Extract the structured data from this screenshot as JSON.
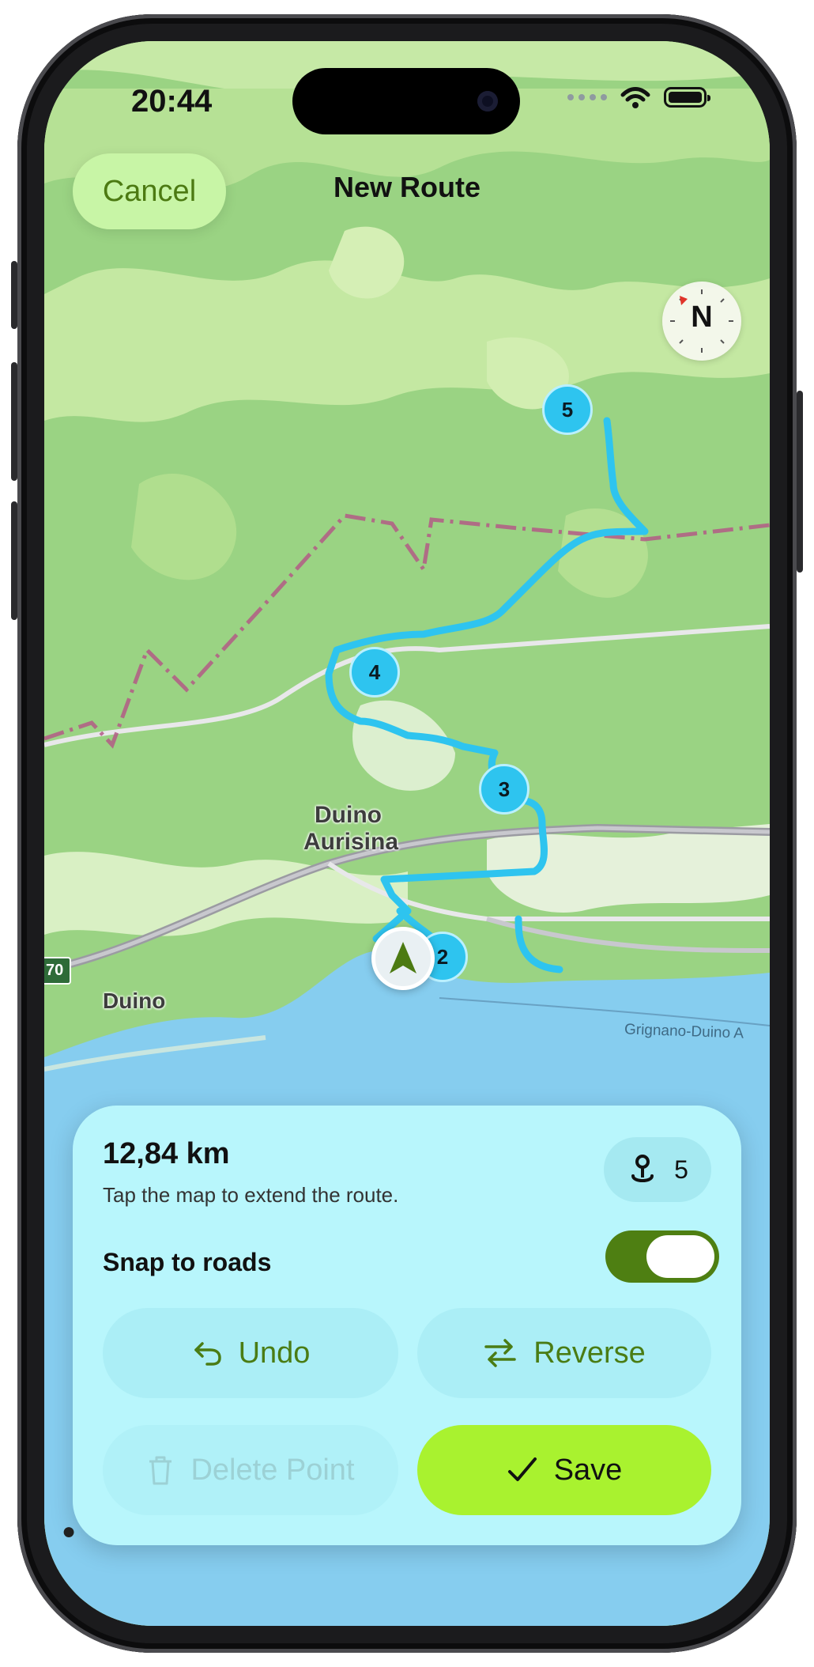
{
  "status_bar": {
    "time": "20:44"
  },
  "nav": {
    "cancel_label": "Cancel",
    "title": "New Route"
  },
  "compass": {
    "label": "N"
  },
  "map": {
    "places": {
      "duino_aurisina_line1": "Duino",
      "duino_aurisina_line2": "Aurisina",
      "duino": "Duino"
    },
    "road_label": "Grignano-Duino A",
    "shield": "70",
    "waypoints": [
      "2",
      "3",
      "4",
      "5"
    ]
  },
  "panel": {
    "distance": "12,84 km",
    "hint": "Tap the map to extend the route.",
    "point_count": "5",
    "snap_label": "Snap to roads",
    "snap_enabled": true,
    "undo_label": "Undo",
    "reverse_label": "Reverse",
    "delete_label": "Delete Point",
    "save_label": "Save"
  },
  "colors": {
    "route": "#2ec4ef",
    "accent": "#a9f22f",
    "toggle_on": "#4e7f12",
    "panel": "#baf8fc",
    "water": "#86cdef"
  },
  "icons": [
    "wifi-icon",
    "battery-icon",
    "compass-icon",
    "location-arrow-icon",
    "waypoint-pin-icon",
    "undo-icon",
    "reverse-icon",
    "trash-icon",
    "checkmark-icon"
  ]
}
